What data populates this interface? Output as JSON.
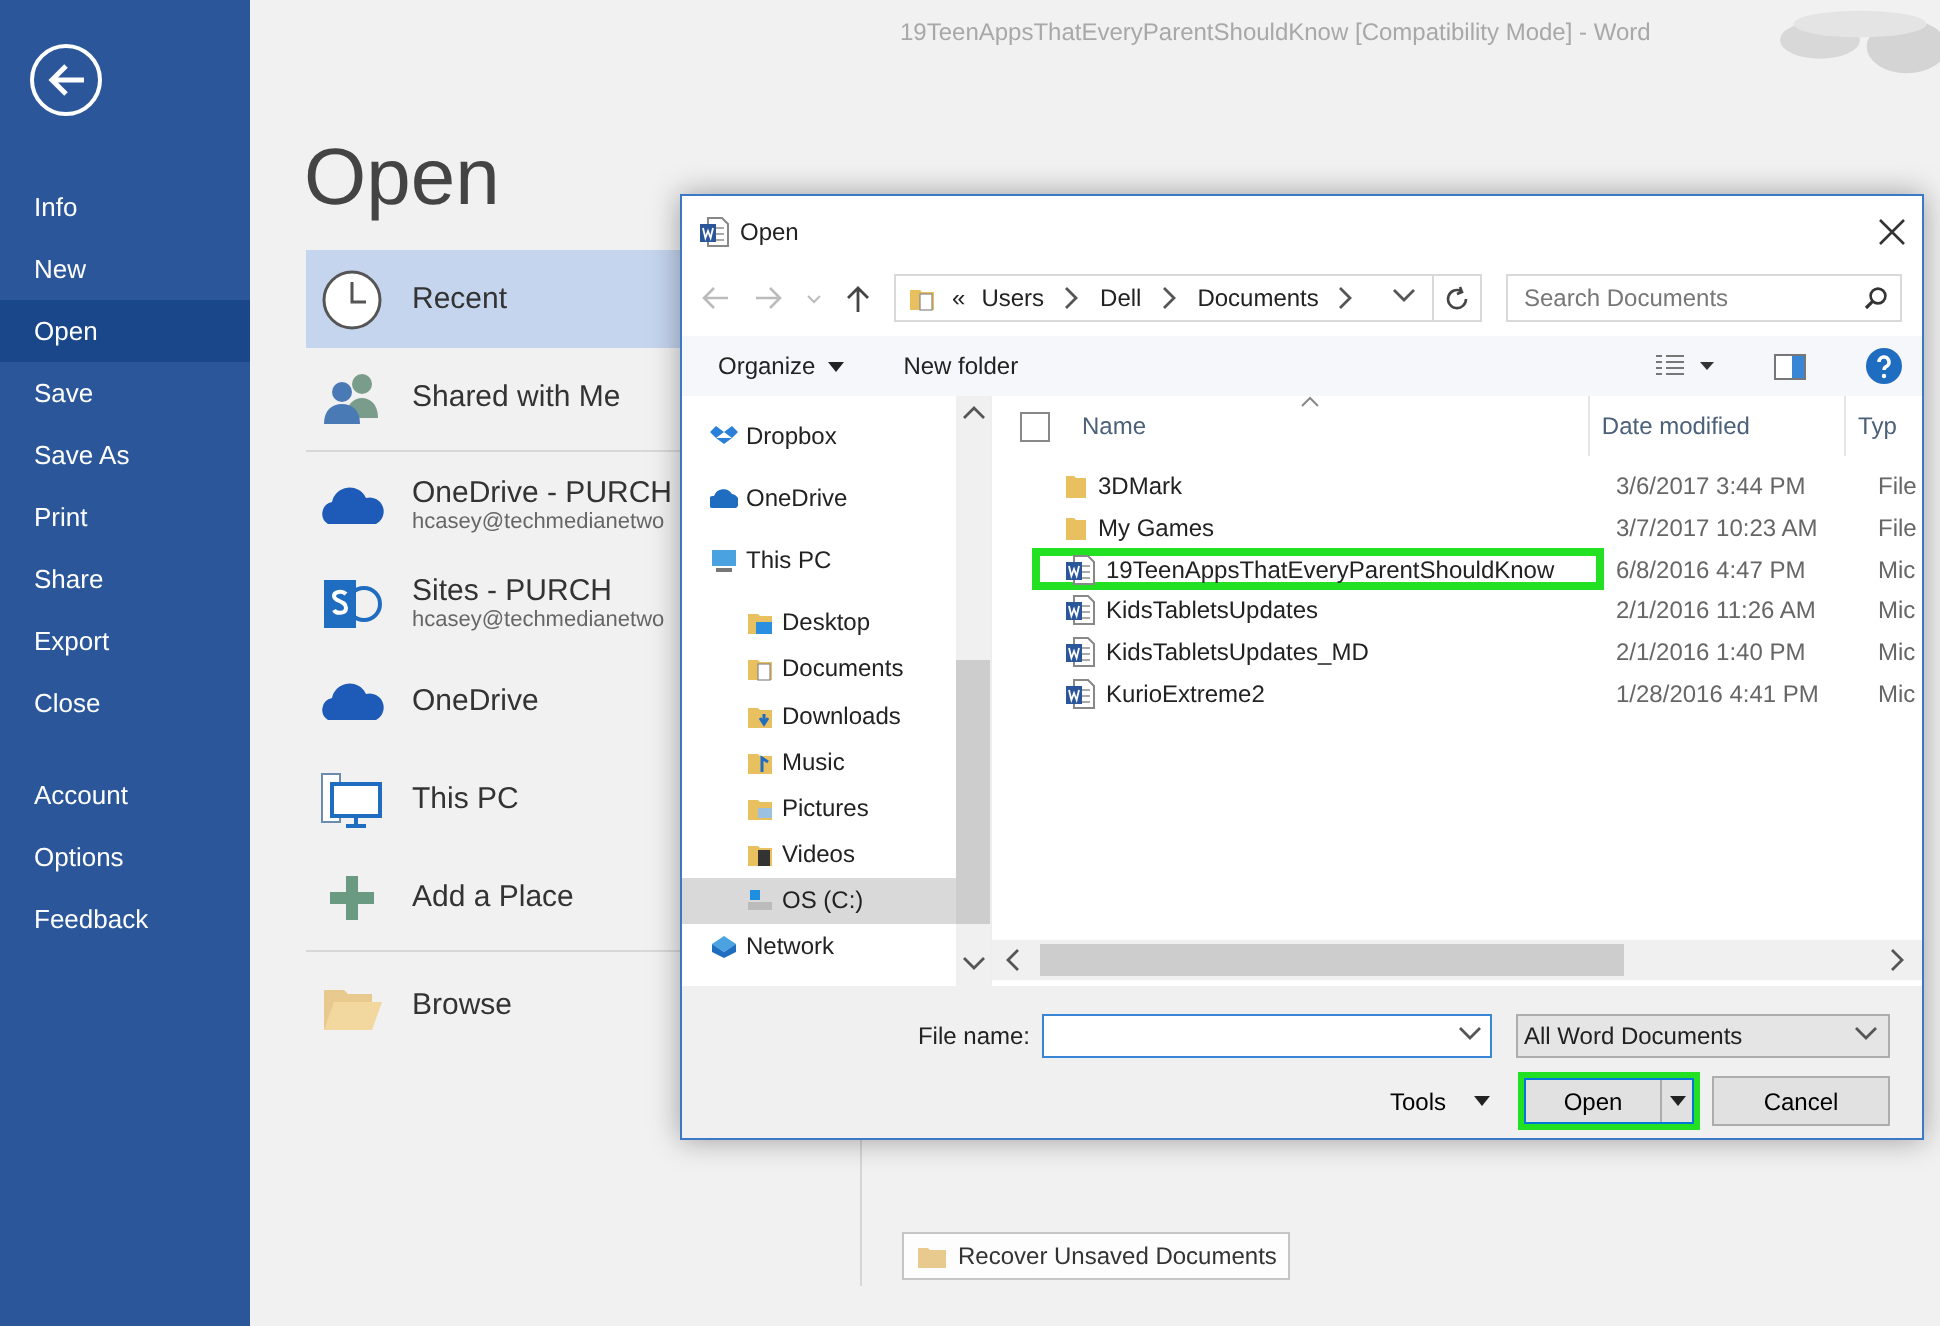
{
  "window": {
    "title": "19TeenAppsThatEveryParentShouldKnow [Compatibility Mode]  -  Word"
  },
  "backstage_nav": {
    "groups": [
      {
        "items": [
          {
            "label": "Info",
            "selected": false
          },
          {
            "label": "New",
            "selected": false
          },
          {
            "label": "Open",
            "selected": true
          },
          {
            "label": "Save",
            "selected": false
          },
          {
            "label": "Save As",
            "selected": false
          },
          {
            "label": "Print",
            "selected": false
          },
          {
            "label": "Share",
            "selected": false
          },
          {
            "label": "Export",
            "selected": false
          },
          {
            "label": "Close",
            "selected": false
          }
        ]
      },
      {
        "items": [
          {
            "label": "Account",
            "selected": false
          },
          {
            "label": "Options",
            "selected": false
          },
          {
            "label": "Feedback",
            "selected": false
          }
        ]
      }
    ]
  },
  "page": {
    "heading": "Open",
    "place_groups": [
      {
        "items": [
          {
            "kind": "recent",
            "label": "Recent",
            "selected": true
          },
          {
            "kind": "shared",
            "label": "Shared with Me",
            "selected": false
          }
        ]
      },
      {
        "items": [
          {
            "kind": "onedrive",
            "label": "OneDrive - PURCH",
            "detail": "hcasey@techmedianetwo",
            "selected": false
          },
          {
            "kind": "sites",
            "label": "Sites - PURCH",
            "detail": "hcasey@techmedianetwo",
            "selected": false
          },
          {
            "kind": "onedrive",
            "label": "OneDrive",
            "selected": false
          },
          {
            "kind": "pc",
            "label": "This PC",
            "selected": false
          },
          {
            "kind": "add",
            "label": "Add a Place",
            "selected": false
          }
        ]
      },
      {
        "items": [
          {
            "kind": "browse",
            "label": "Browse",
            "selected": false
          }
        ]
      }
    ],
    "recover_button": "Recover Unsaved Documents"
  },
  "dialog": {
    "title": "Open",
    "breadcrumb_prefix": "«",
    "breadcrumb": [
      "Users",
      "Dell",
      "Documents"
    ],
    "search": {
      "placeholder": "Search Documents"
    },
    "toolbar": {
      "organize": "Organize",
      "new_folder": "New folder"
    },
    "nav_tree": [
      {
        "kind": "dropbox",
        "label": "Dropbox",
        "selected": false
      },
      {
        "kind": "onedrive",
        "label": "OneDrive",
        "selected": false
      },
      {
        "kind": "pc",
        "label": "This PC",
        "selected": false,
        "children": [
          {
            "kind": "desktop",
            "label": "Desktop",
            "selected": false
          },
          {
            "kind": "documents",
            "label": "Documents",
            "selected": false
          },
          {
            "kind": "downloads",
            "label": "Downloads",
            "selected": false
          },
          {
            "kind": "music",
            "label": "Music",
            "selected": false
          },
          {
            "kind": "pictures",
            "label": "Pictures",
            "selected": false
          },
          {
            "kind": "videos",
            "label": "Videos",
            "selected": false
          },
          {
            "kind": "drive",
            "label": "OS (C:)",
            "selected": true
          }
        ]
      },
      {
        "kind": "network",
        "label": "Network",
        "selected": false
      }
    ],
    "select_all": {
      "checked": false
    },
    "columns": [
      "Name",
      "Date modified",
      "Typ"
    ],
    "files": [
      {
        "kind": "folder",
        "name": "3DMark",
        "date": "3/6/2017 3:44 PM",
        "type": "File",
        "highlighted": false
      },
      {
        "kind": "folder",
        "name": "My Games",
        "date": "3/7/2017 10:23 AM",
        "type": "File",
        "highlighted": false
      },
      {
        "kind": "document",
        "name": "19TeenAppsThatEveryParentShouldKnow",
        "date": "6/8/2016 4:47 PM",
        "type": "Mic",
        "highlighted": true
      },
      {
        "kind": "document",
        "name": "KidsTabletsUpdates",
        "date": "2/1/2016 11:26 AM",
        "type": "Mic",
        "highlighted": false
      },
      {
        "kind": "document",
        "name": "KidsTabletsUpdates_MD",
        "date": "2/1/2016 1:40 PM",
        "type": "Mic",
        "highlighted": false
      },
      {
        "kind": "document",
        "name": "KurioExtreme2",
        "date": "1/28/2016 4:41 PM",
        "type": "Mic",
        "highlighted": false
      }
    ],
    "file_name_label": "File name:",
    "file_type": "All Word Documents",
    "tools": "Tools",
    "open_button": {
      "label": "Open",
      "highlighted": true
    },
    "cancel_button": "Cancel"
  }
}
